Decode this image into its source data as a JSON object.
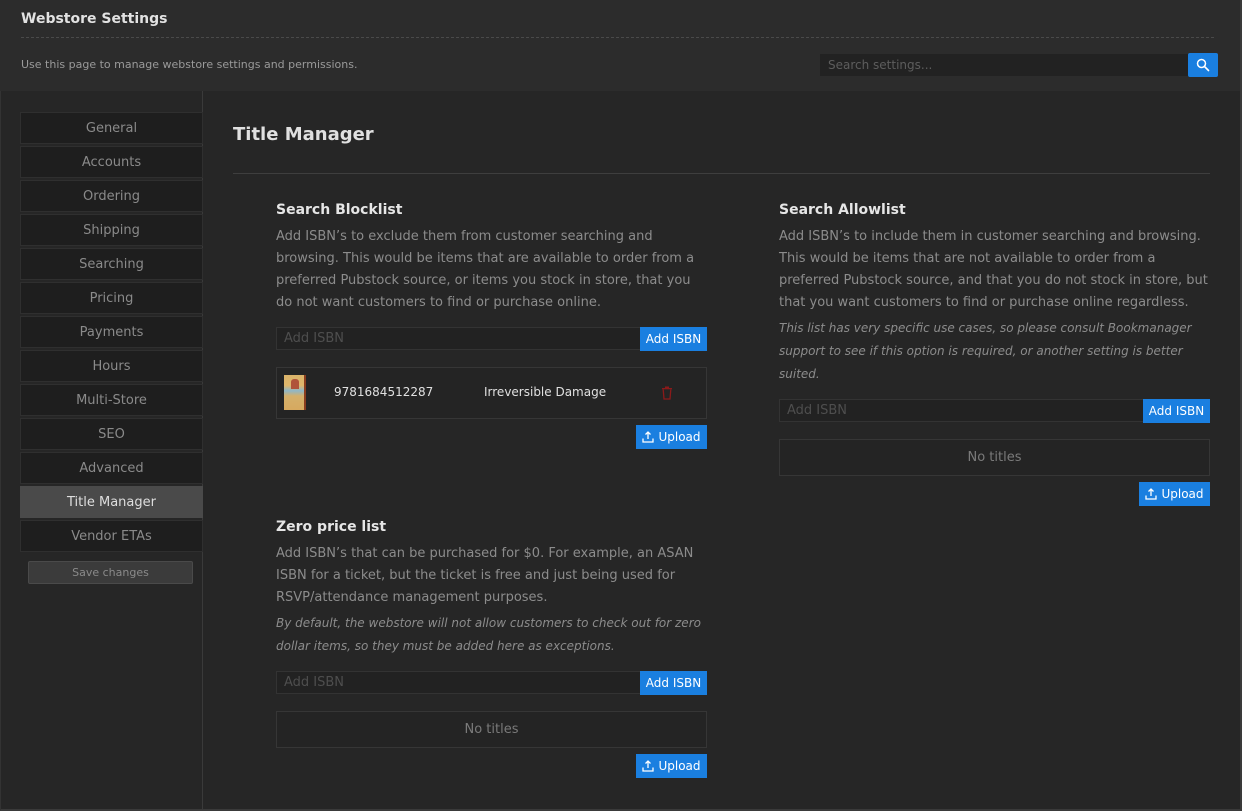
{
  "header": {
    "title": "Webstore Settings",
    "description": "Use this page to manage webstore settings and permissions.",
    "search_placeholder": "Search settings...",
    "search_icon": "search-icon"
  },
  "sidebar": {
    "items": [
      {
        "label": "General"
      },
      {
        "label": "Accounts"
      },
      {
        "label": "Ordering"
      },
      {
        "label": "Shipping"
      },
      {
        "label": "Searching"
      },
      {
        "label": "Pricing"
      },
      {
        "label": "Payments"
      },
      {
        "label": "Hours"
      },
      {
        "label": "Multi-Store"
      },
      {
        "label": "SEO"
      },
      {
        "label": "Advanced"
      },
      {
        "label": "Title Manager",
        "active": true
      },
      {
        "label": "Vendor ETAs"
      }
    ],
    "save_label": "Save changes"
  },
  "main": {
    "page_title": "Title Manager",
    "blocklist": {
      "heading": "Search Blocklist",
      "description": "Add ISBN’s to exclude them from customer searching and browsing. This would be items that are available to order from a preferred Pubstock source, or items you stock in store, that you do not want customers to find or purchase online.",
      "input_placeholder": "Add ISBN",
      "add_label": "Add ISBN",
      "titles": [
        {
          "isbn": "9781684512287",
          "title": "Irreversible Damage"
        }
      ],
      "upload_label": "Upload"
    },
    "allowlist": {
      "heading": "Search Allowlist",
      "description": "Add ISBN’s to include them in customer searching and browsing. This would be items that are not available to order from a preferred Pubstock source, and that you do not stock in store, but that you want customers to find or purchase online regardless.",
      "note": "This list has very specific use cases, so please consult Bookmanager support to see if this option is required, or another setting is better suited.",
      "input_placeholder": "Add ISBN",
      "add_label": "Add ISBN",
      "empty_label": "No titles",
      "upload_label": "Upload"
    },
    "zeroprice": {
      "heading": "Zero price list",
      "description": "Add ISBN’s that can be purchased for $0. For example, an ASAN ISBN for a ticket, but the ticket is free and just being used for RSVP/attendance management purposes.",
      "note": "By default, the webstore will not allow customers to check out for zero dollar items, so they must be added here as exceptions.",
      "input_placeholder": "Add ISBN",
      "add_label": "Add ISBN",
      "empty_label": "No titles",
      "upload_label": "Upload"
    }
  },
  "colors": {
    "accent": "#1a7fe0",
    "delete": "#8b1a1a",
    "active_nav": "#4a4a4a"
  }
}
